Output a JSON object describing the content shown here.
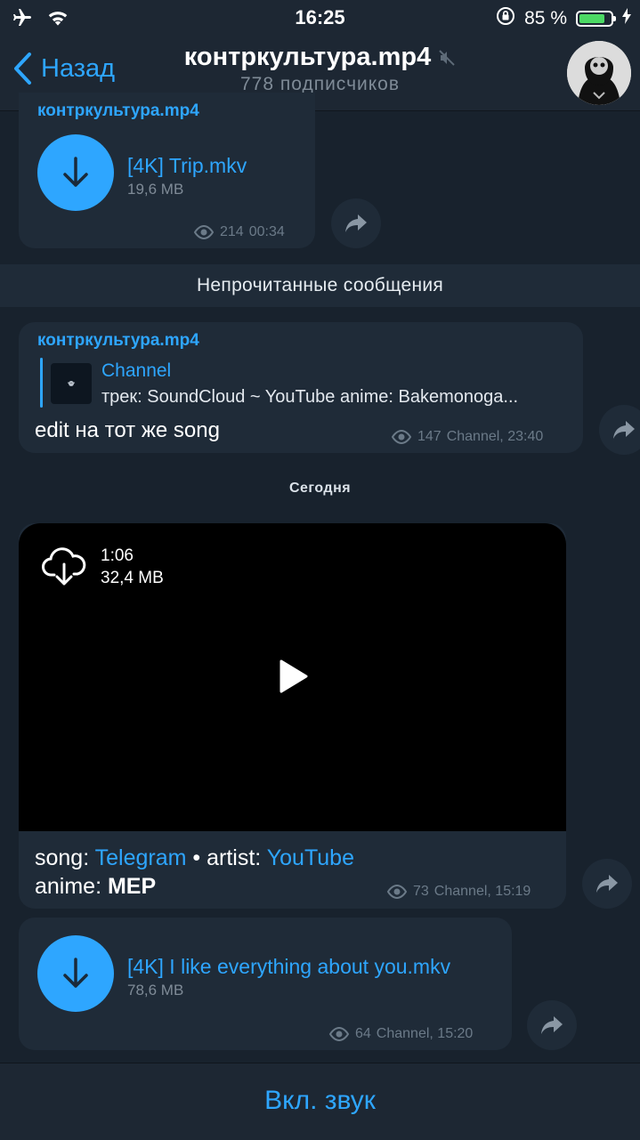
{
  "status_bar": {
    "time": "16:25",
    "battery_text": "85 %",
    "battery_level": 0.85,
    "icons": [
      "airplane-icon",
      "wifi-icon",
      "rotation-lock-icon",
      "battery-icon",
      "charging-icon"
    ]
  },
  "header": {
    "back_label": "Назад",
    "title": "контркультура.mp4",
    "subtitle": "778 подписчиков",
    "muted": true
  },
  "messages": {
    "msg1": {
      "author": "контркультура.mp4",
      "file_name": "[4K] Trip.mkv",
      "file_size": "19,6 MB",
      "views": "214",
      "time": "00:34"
    },
    "unread_label": "Непрочитанные сообщения",
    "msg2": {
      "author": "контркультура.mp4",
      "reply_title": "Channel",
      "reply_text": "трек: SoundCloud ~ YouTube anime: Bakemonoga...",
      "text": "edit на тот же song",
      "views": "147",
      "time": "Channel, 23:40"
    },
    "date_label": "Сегодня",
    "msg3": {
      "duration": "1:06",
      "size": "32,4 MB",
      "caption_song_label": "song: ",
      "caption_song_link": "Telegram",
      "caption_artist_label": " • artist: ",
      "caption_artist_link": "YouTube",
      "caption_anime_label": "anime: ",
      "caption_anime_value": "МЕР",
      "views": "73",
      "time": "Channel, 15:19"
    },
    "msg4": {
      "file_name": "[4K] I like everything about you.mkv",
      "file_size": "78,6 MB",
      "views": "64",
      "time": "Channel, 15:20"
    }
  },
  "bottom": {
    "unmute_label": "Вкл. звук"
  },
  "colors": {
    "accent": "#2ea6ff",
    "background": "#18222d",
    "bubble": "#1f2b38",
    "meta": "#6b7a88"
  }
}
